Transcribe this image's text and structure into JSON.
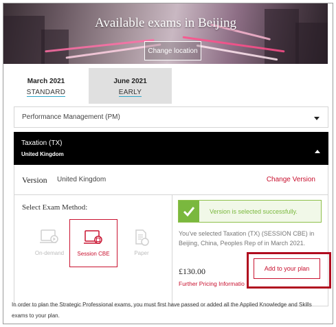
{
  "hero": {
    "title": "Available exams in Beijing",
    "change_location_label": "Change location"
  },
  "tabs": [
    {
      "month": "March 2021",
      "session": "STANDARD"
    },
    {
      "month": "June 2021",
      "session": "EARLY"
    }
  ],
  "accordion": {
    "collapsed_item": "Performance Management (PM)",
    "expanded_item": {
      "title": "Taxation (TX)",
      "subtitle": "United Kingdom"
    }
  },
  "version": {
    "label": "Version",
    "value": "United Kingdom",
    "change_label": "Change Version"
  },
  "exam_method": {
    "heading": "Select Exam Method:",
    "options": [
      {
        "label": "On-demand",
        "icon": "on-demand-icon",
        "selected": false
      },
      {
        "label": "Session CBE",
        "icon": "session-cbe-icon",
        "selected": true
      },
      {
        "label": "Paper",
        "icon": "paper-icon",
        "selected": false
      }
    ]
  },
  "summary": {
    "success_message": "Version is selected successfully.",
    "selected_text": "You've selected Taxation (TX) (SESSION CBE) in Beijing, China, Peoples Rep of in March 2021.",
    "price": "£130.00",
    "further_pricing": "Further Pricing Informatio",
    "add_button": "Add to your plan"
  },
  "footer_note": "In order to plan the Strategic Professional exams, you must first have passed or added all the Applied Knowledge and Skills exams to your plan.",
  "colors": {
    "accent": "#c8102e",
    "success": "#7ab83e",
    "tab_underline": "#2aa6c9"
  }
}
